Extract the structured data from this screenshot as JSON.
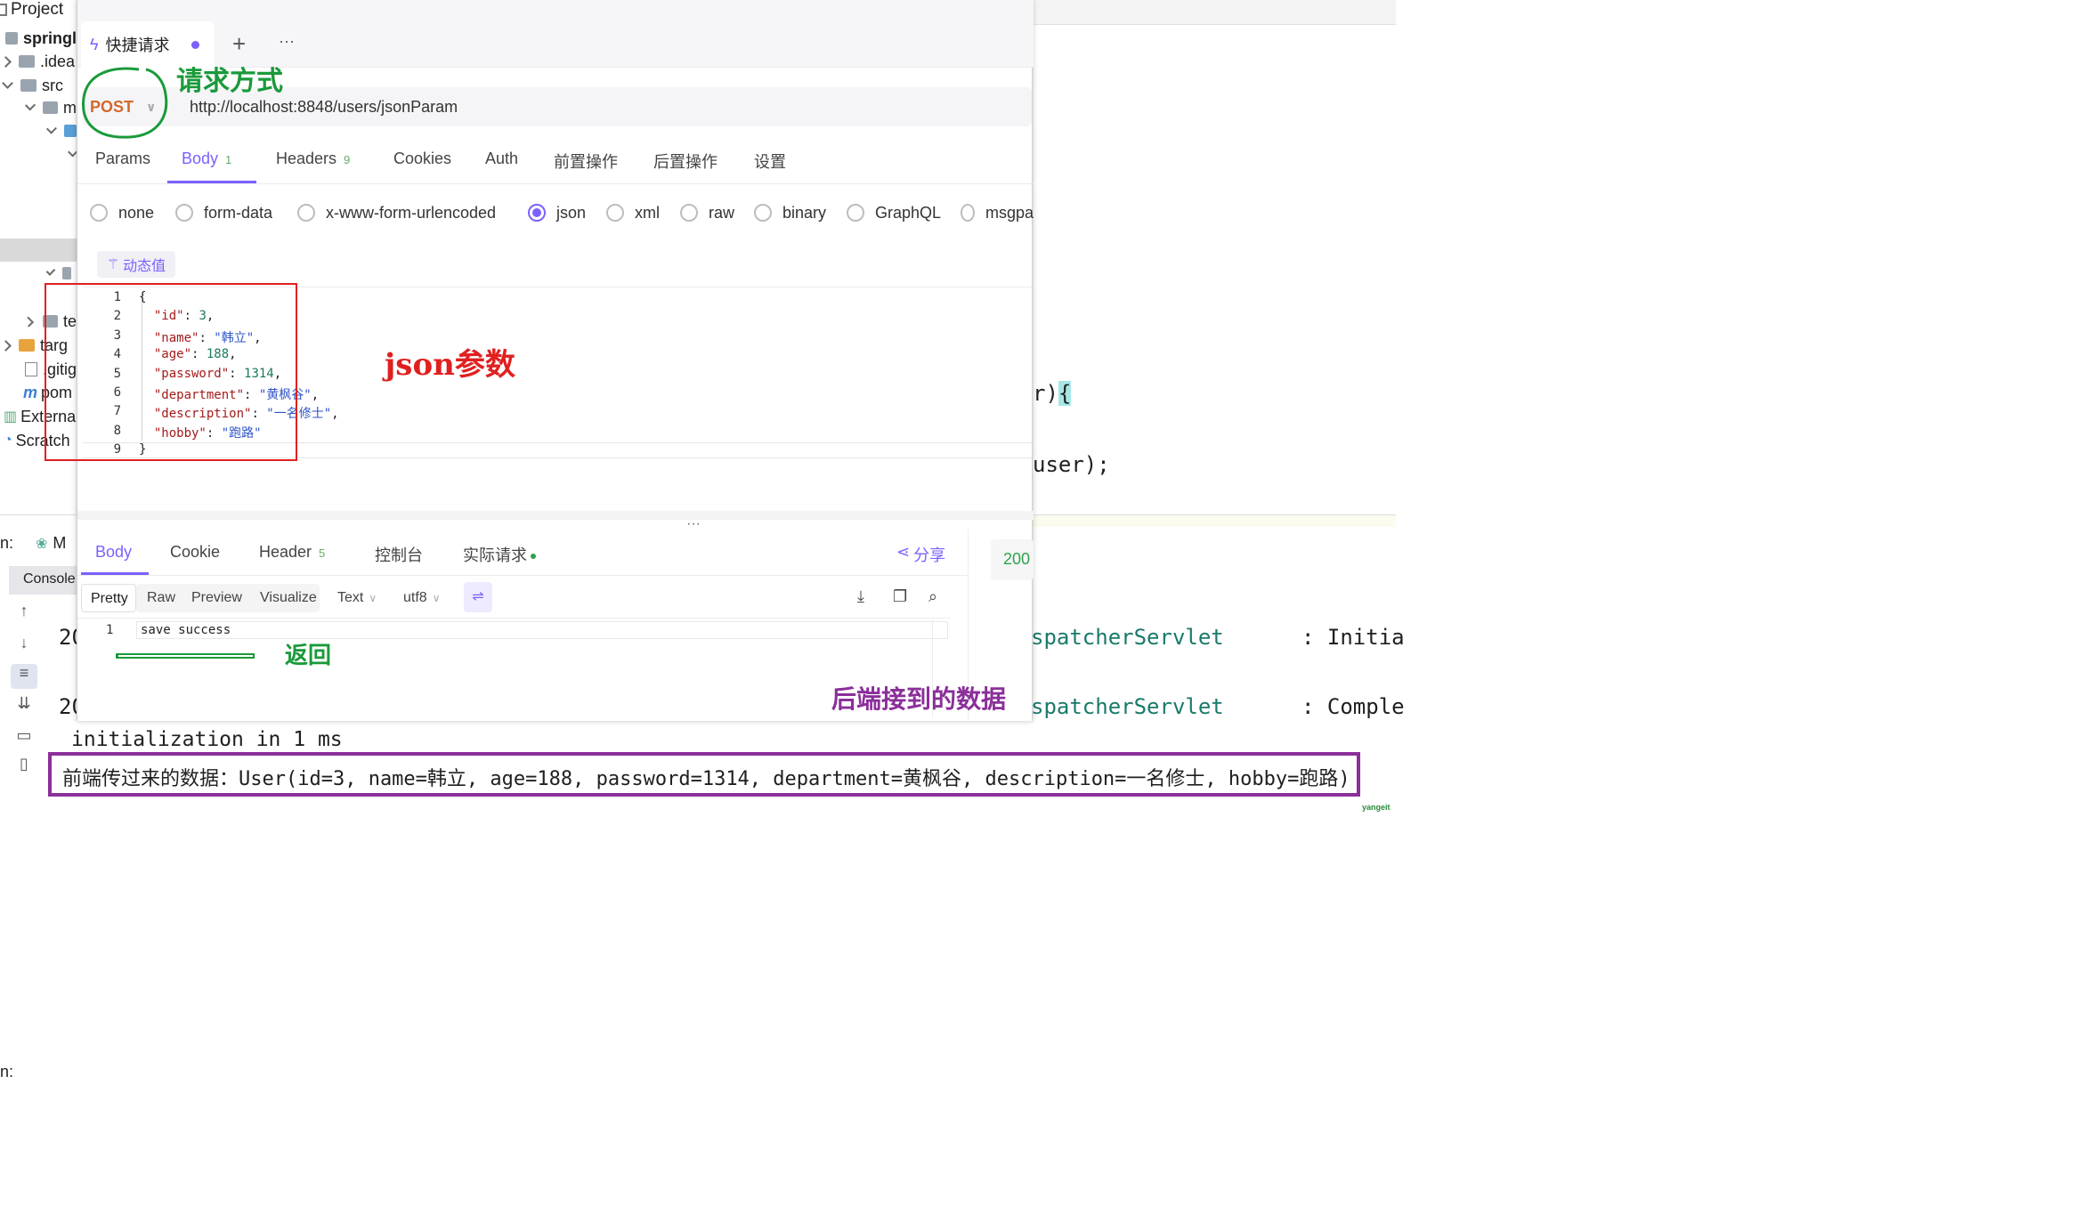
{
  "ide": {
    "project_label": "Project",
    "tree": [
      "springl",
      ".idea",
      "src",
      "m",
      "",
      "",
      "te",
      "targ",
      ".gitig",
      "pom",
      "Externa",
      "Scratch"
    ],
    "run_label": "n:",
    "run_tab": "M",
    "console_tab": "Console",
    "right_code": [
      ")){",
      "user);"
    ],
    "console_right": [
      {
        "src": "spatcherServlet",
        "msg": ": Initia"
      },
      {
        "src": "spatcherServlet",
        "msg": ": Comple"
      }
    ],
    "console_left": [
      "20",
      "20"
    ],
    "console_line": "initialization in 1 ms",
    "backend_output": "前端传过来的数据：User(id=3, name=韩立, age=188, password=1314, department=黄枫谷, description=一名修士, hobby=跑路)"
  },
  "request": {
    "tab_title": "快捷请求",
    "add_tab": "+",
    "more": "···",
    "method": "POST",
    "url": "http://localhost:8848/users/jsonParam",
    "tabs": [
      {
        "label": "Params",
        "badge": ""
      },
      {
        "label": "Body",
        "badge": "1"
      },
      {
        "label": "Headers",
        "badge": "9"
      },
      {
        "label": "Cookies",
        "badge": ""
      },
      {
        "label": "Auth",
        "badge": ""
      },
      {
        "label": "前置操作",
        "badge": ""
      },
      {
        "label": "后置操作",
        "badge": ""
      },
      {
        "label": "设置",
        "badge": ""
      }
    ],
    "body_types": [
      "none",
      "form-data",
      "x-www-form-urlencoded",
      "json",
      "xml",
      "raw",
      "binary",
      "GraphQL",
      "msgpa"
    ],
    "selected_body_type": "json",
    "dynamic_value": "动态值",
    "json_lines": [
      "{",
      "  \"id\": 3,",
      "  \"name\": \"韩立\",",
      "  \"age\": 188,",
      "  \"password\": 1314,",
      "  \"department\": \"黄枫谷\",",
      "  \"description\": \"一名修士\",",
      "  \"hobby\": \"跑路\"",
      "}"
    ]
  },
  "response": {
    "tabs": [
      {
        "label": "Body",
        "badge": ""
      },
      {
        "label": "Cookie",
        "badge": ""
      },
      {
        "label": "Header",
        "badge": "5"
      },
      {
        "label": "控制台",
        "badge": ""
      },
      {
        "label": "实际请求",
        "badge": ""
      }
    ],
    "share": "分享",
    "status": "200",
    "formats": [
      "Pretty",
      "Raw",
      "Preview",
      "Visualize"
    ],
    "text_select": "Text",
    "encoding_select": "utf8",
    "body_line": "save success"
  },
  "annotations": {
    "method": "请求方式",
    "json_params": "json参数",
    "return": "返回",
    "backend_data": "后端接到的数据"
  },
  "watermark": "yangeit",
  "colors": {
    "accent": "#7b61ff",
    "method": "#d4682b",
    "annotation_green": "#1a9a3a",
    "annotation_red": "#e02020",
    "annotation_purple": "#8b2f9a"
  }
}
